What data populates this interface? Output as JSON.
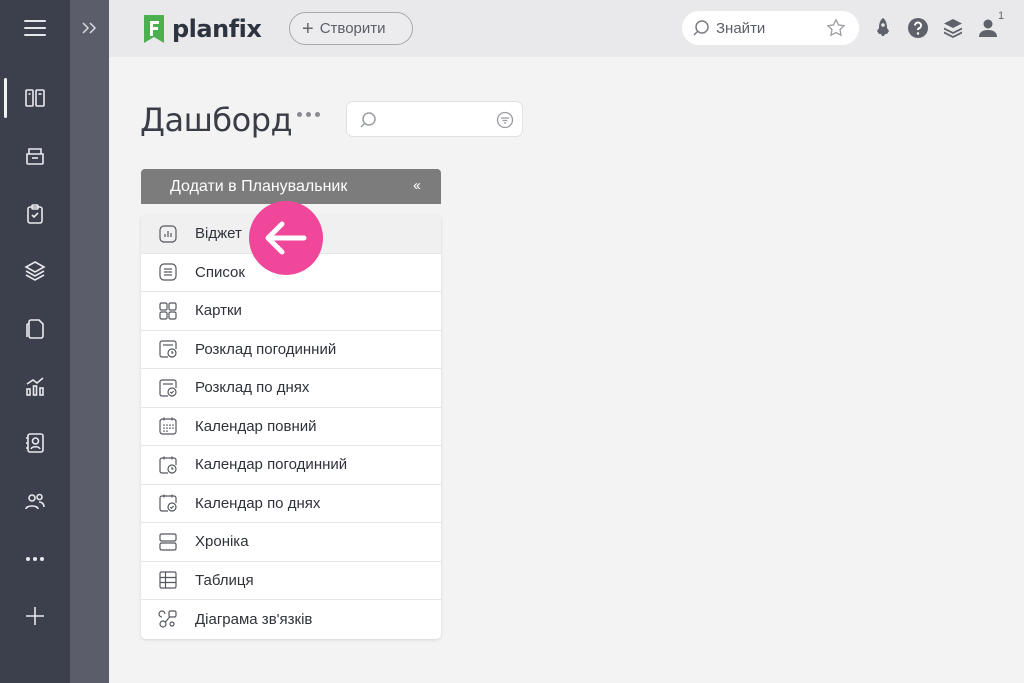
{
  "app": {
    "name": "planfix"
  },
  "topbar": {
    "create_label": "Створити",
    "search_placeholder": "Знайти",
    "notification_count": "1"
  },
  "page": {
    "title": "Дашборд"
  },
  "panel": {
    "header": "Додати в Планувальник",
    "items": [
      {
        "label": "Віджет",
        "icon": "widget-chart-icon"
      },
      {
        "label": "Список",
        "icon": "list-icon"
      },
      {
        "label": "Картки",
        "icon": "cards-icon"
      },
      {
        "label": "Розклад погодинний",
        "icon": "schedule-hourly-icon"
      },
      {
        "label": "Розклад по днях",
        "icon": "schedule-daily-icon"
      },
      {
        "label": "Календар повний",
        "icon": "calendar-full-icon"
      },
      {
        "label": "Календар погодинний",
        "icon": "calendar-hourly-icon"
      },
      {
        "label": "Календар по днях",
        "icon": "calendar-daily-icon"
      },
      {
        "label": "Хроніка",
        "icon": "timeline-icon"
      },
      {
        "label": "Таблиця",
        "icon": "table-icon"
      },
      {
        "label": "Діаграма зв'язків",
        "icon": "relations-diagram-icon"
      }
    ]
  },
  "colors": {
    "sidebar": "#3c3f4c",
    "strip": "#5b5d6b",
    "brand_green": "#4cb050",
    "pointer": "#f0479b",
    "panel_header": "#7c7c7c"
  }
}
